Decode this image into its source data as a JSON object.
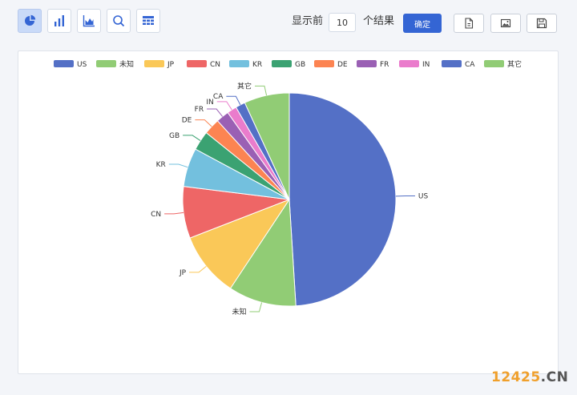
{
  "toolbar": {
    "views": [
      {
        "name": "pie-view-button",
        "icon": "pie-chart-icon",
        "active": true
      },
      {
        "name": "bar-view-button",
        "icon": "bar-chart-icon",
        "active": false
      },
      {
        "name": "area-view-button",
        "icon": "area-chart-icon",
        "active": false
      },
      {
        "name": "search-button",
        "icon": "search-icon",
        "active": false
      },
      {
        "name": "table-view-button",
        "icon": "table-icon",
        "active": false
      }
    ],
    "show_label": "显示前",
    "count_value": "10",
    "result_label": "个结果",
    "confirm_label": "确定",
    "export_buttons": [
      {
        "name": "export-file-button",
        "icon": "file-export-icon"
      },
      {
        "name": "export-image-button",
        "icon": "image-icon"
      },
      {
        "name": "save-button",
        "icon": "save-icon"
      }
    ]
  },
  "chart_data": {
    "type": "pie",
    "legend": [
      "US",
      "未知",
      "JP",
      "CN",
      "KR",
      "GB",
      "DE",
      "FR",
      "IN",
      "CA",
      "其它"
    ],
    "series": [
      {
        "name": "US",
        "value": 50.0,
        "color": "#5470c6"
      },
      {
        "name": "未知",
        "value": 10.5,
        "color": "#91cc75"
      },
      {
        "name": "JP",
        "value": 10.0,
        "color": "#fac858"
      },
      {
        "name": "CN",
        "value": 8.0,
        "color": "#ee6666"
      },
      {
        "name": "KR",
        "value": 6.0,
        "color": "#73c0de"
      },
      {
        "name": "GB",
        "value": 3.0,
        "color": "#3ba272"
      },
      {
        "name": "DE",
        "value": 2.5,
        "color": "#fc8452"
      },
      {
        "name": "FR",
        "value": 2.0,
        "color": "#9a60b4"
      },
      {
        "name": "IN",
        "value": 1.5,
        "color": "#ea7ccc"
      },
      {
        "name": "CA",
        "value": 1.5,
        "color": "#5470c6"
      },
      {
        "name": "其它",
        "value": 7.0,
        "color": "#91cc75"
      }
    ],
    "legend_position": "top"
  },
  "watermark": {
    "part1": "12425",
    "part2": ".CN"
  }
}
